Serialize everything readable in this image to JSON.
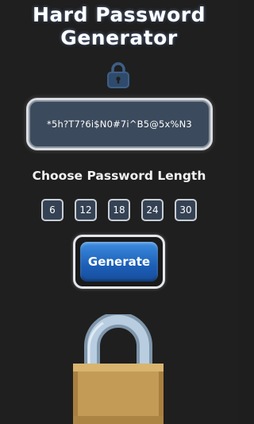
{
  "app": {
    "title": "Hard Password Generator"
  },
  "password": {
    "value": "*5h?T7?6i$N0#7i^B5@5x%N3"
  },
  "length_section": {
    "label": "Choose Password Length",
    "options": [
      "6",
      "12",
      "18",
      "24",
      "30"
    ]
  },
  "actions": {
    "generate_label": "Generate"
  },
  "icons": {
    "header_icon": "lock-icon",
    "footer_art": "padlock-illustration"
  },
  "colors": {
    "background": "#1f1f1f",
    "panel": "#3b4a5c",
    "accent_blue": "#1c5fb7",
    "lock_gold": "#c49a57",
    "lock_shackle": "#a9c0d6"
  }
}
